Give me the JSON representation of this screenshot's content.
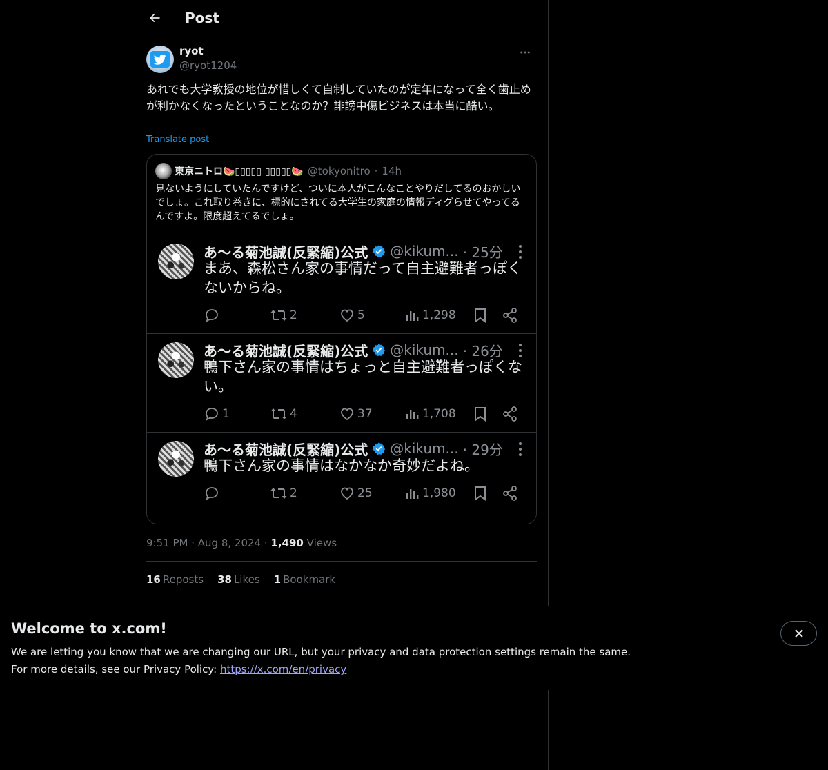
{
  "header": {
    "title": "Post"
  },
  "post": {
    "author_name": "ryot",
    "author_handle": "@ryot1204",
    "text": "あれでも大学教授の地位が惜しくて自制していたのが定年になって全く歯止めが利かなくなったということなのか？誹謗中傷ビジネスは本当に酷い。",
    "translate_label": "Translate post",
    "time": "9:51 PM",
    "date": "Aug 8, 2024",
    "views_count": "1,490",
    "views_label": "Views",
    "reposts_count": "16",
    "reposts_label": "Reposts",
    "likes_count": "38",
    "likes_label": "Likes",
    "bookmarks_count": "1",
    "bookmarks_label": "Bookmark"
  },
  "quote": {
    "name": "東京ニトロ🍉▯▯▯▯▯ ▯▯▯▯▯🍉",
    "handle": "@tokyonitro",
    "separator": "·",
    "time": "14h",
    "text": "見ないようにしていたんですけど、ついに本人がこんなことやりだしてるのおかしいでしょ。これ取り巻きに、標的にされてる大学生の家庭の情報ディグらせてやってるんですよ。限度超えてるでしょ。",
    "image_tweets": [
      {
        "name": "あ〜る菊池誠(反緊縮)公式",
        "handle": "@kikum...",
        "time": "· 25分",
        "text": "まあ、森松さん家の事情だって自主避難者っぽくないからね。",
        "replies": "",
        "reposts": "2",
        "likes": "5",
        "views": "1,298"
      },
      {
        "name": "あ〜る菊池誠(反緊縮)公式",
        "handle": "@kikum...",
        "time": "· 26分",
        "text": "鴨下さん家の事情はちょっと自主避難者っぽくない。",
        "replies": "1",
        "reposts": "4",
        "likes": "37",
        "views": "1,708"
      },
      {
        "name": "あ〜る菊池誠(反緊縮)公式",
        "handle": "@kikum...",
        "time": "· 29分",
        "text": "鴨下さん家の事情はなかなか奇妙だよね。",
        "replies": "",
        "reposts": "2",
        "likes": "25",
        "views": "1,980"
      }
    ]
  },
  "banner": {
    "title": "Welcome to x.com!",
    "line1": "We are letting you know that we are changing our URL, but your privacy and data protection settings remain the same.",
    "line2_prefix": "For more details, see our Privacy Policy: ",
    "link": "https://x.com/en/privacy"
  },
  "icons": {
    "back": "arrow-left-icon",
    "more": "more-horizontal-icon",
    "close": "close-icon",
    "verified": "verified-badge-icon",
    "reply": "reply-icon",
    "repost": "repost-icon",
    "like": "heart-icon",
    "views": "views-icon",
    "bookmark": "bookmark-icon",
    "share": "share-icon"
  },
  "colors": {
    "background": "#000000",
    "text": "#e7e9ea",
    "muted": "#71767b",
    "accent": "#1d9bf0",
    "border": "#2f3336",
    "link": "#a0a6f7"
  }
}
